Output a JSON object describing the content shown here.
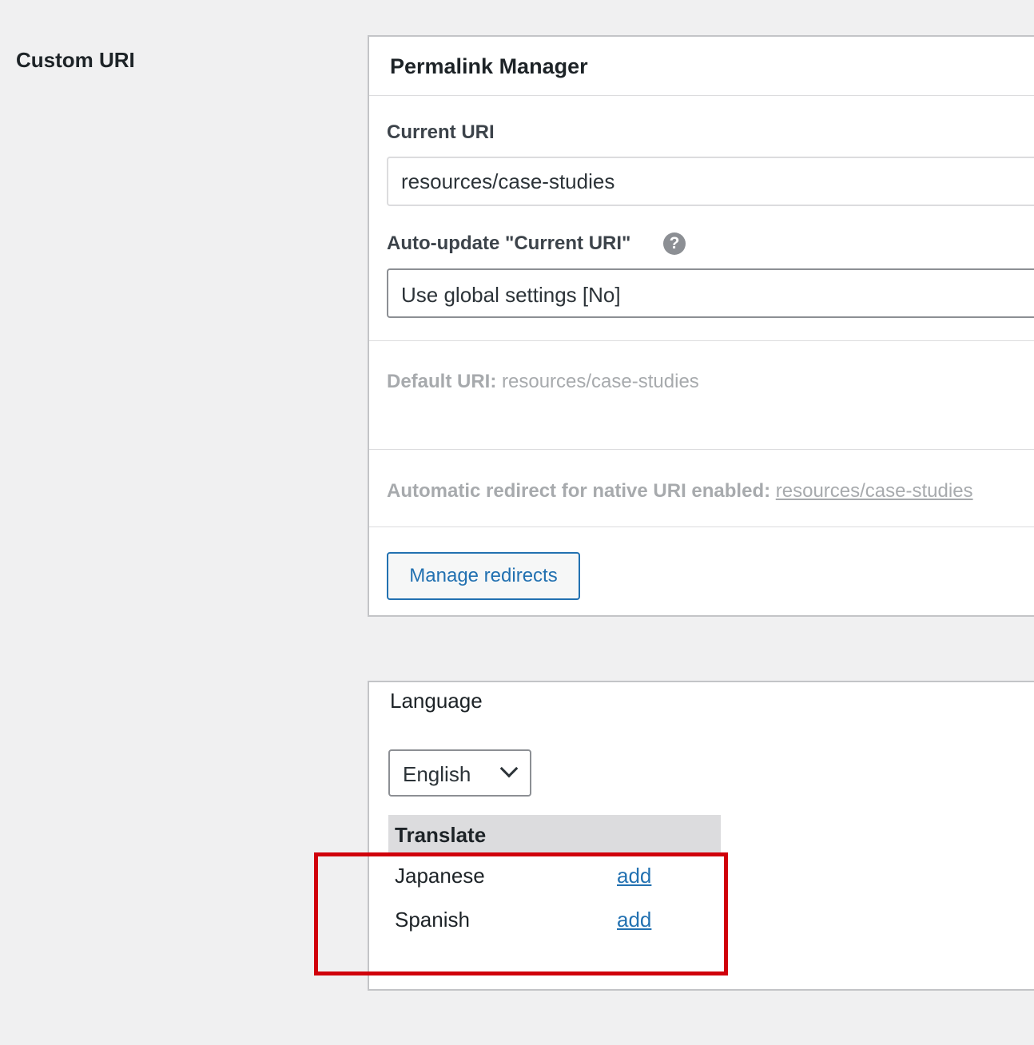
{
  "side": {
    "label": "Custom URI"
  },
  "permalink_manager": {
    "title": "Permalink Manager",
    "current_uri_label": "Current URI",
    "current_uri_value": "resources/case-studies",
    "auto_update_label": "Auto-update \"Current URI\"",
    "help_icon": "?",
    "auto_update_value": "Use global settings [No]",
    "default_uri_label": "Default URI:",
    "default_uri_value": "resources/case-studies",
    "redirect_label": "Automatic redirect for native URI enabled:",
    "redirect_link": "resources/case-studies",
    "manage_redirects_button": "Manage redirects"
  },
  "language": {
    "title": "Language",
    "selected": "English",
    "translate_header": "Translate",
    "rows": [
      {
        "language": "Japanese",
        "action": "add"
      },
      {
        "language": "Spanish",
        "action": "add"
      }
    ]
  },
  "colors": {
    "highlight": "#d0000b",
    "link": "#2271b1",
    "background": "#f0f0f1"
  }
}
